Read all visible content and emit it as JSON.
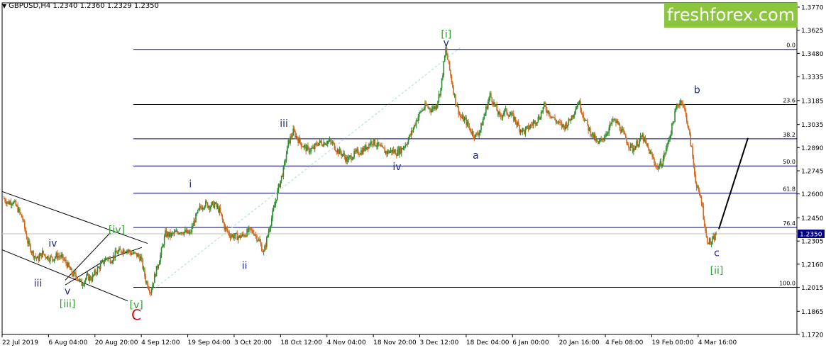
{
  "header": {
    "dropdown_icon": "triangle-down-icon",
    "symbol_info": "GBPUSD,H4  1.2340 1.2360 1.2329 1.2350"
  },
  "brand": {
    "text": "freshforex.com",
    "color": "#8cc63f"
  },
  "chart_data": {
    "type": "candlestick",
    "ylim": [
      1.172,
      1.377
    ],
    "y_ticks": [
      "1.3770",
      "1.3625",
      "1.3480",
      "1.3335",
      "1.3185",
      "1.3035",
      "1.2890",
      "1.2745",
      "1.2600",
      "1.2450",
      "1.2305",
      "1.2160",
      "1.2015",
      "1.1865",
      "1.1720"
    ],
    "y_tick_values": [
      1.377,
      1.3625,
      1.348,
      1.3335,
      1.3185,
      1.3035,
      1.289,
      1.2745,
      1.26,
      1.245,
      1.2305,
      1.216,
      1.2015,
      1.1865,
      1.172
    ],
    "x_ticks": [
      "22 Jul 2019",
      "6 Aug 04:00",
      "20 Aug 20:00",
      "4 Sep 12:00",
      "19 Sep 04:00",
      "3 Oct 20:00",
      "18 Oct 12:00",
      "4 Nov 04:00",
      "18 Nov 20:00",
      "3 Dec 12:00",
      "18 Dec 04:00",
      "6 Jan 00:00",
      "20 Jan 16:00",
      "4 Feb 08:00",
      "19 Feb 00:00",
      "4 Mar 16:00"
    ],
    "current_price": "1.2350",
    "fibonacci_levels": [
      {
        "label": "0.0",
        "price": 1.3505
      },
      {
        "label": "23.6",
        "price": 1.316
      },
      {
        "label": "38.2",
        "price": 1.2945
      },
      {
        "label": "50.0",
        "price": 1.2775
      },
      {
        "label": "61.8",
        "price": 1.2605
      },
      {
        "label": "76.4",
        "price": 1.239
      },
      {
        "label": "100.0",
        "price": 1.2015
      }
    ],
    "price_path": [
      [
        0,
        1.2575
      ],
      [
        1,
        1.2545
      ],
      [
        2,
        1.2555
      ],
      [
        3,
        1.2505
      ],
      [
        4,
        1.244
      ],
      [
        5,
        1.23
      ],
      [
        6,
        1.223
      ],
      [
        7,
        1.219
      ],
      [
        8,
        1.223
      ],
      [
        9,
        1.2205
      ],
      [
        10,
        1.2195
      ],
      [
        11,
        1.2215
      ],
      [
        12,
        1.22
      ],
      [
        13,
        1.216
      ],
      [
        14,
        1.21
      ],
      [
        15,
        1.2085
      ],
      [
        16,
        1.2035
      ],
      [
        17,
        1.208
      ],
      [
        18,
        1.207
      ],
      [
        19,
        1.212
      ],
      [
        20,
        1.216
      ],
      [
        21,
        1.22
      ],
      [
        22,
        1.219
      ],
      [
        23,
        1.223
      ],
      [
        24,
        1.2245
      ],
      [
        25,
        1.2255
      ],
      [
        26,
        1.223
      ],
      [
        27,
        1.222
      ],
      [
        28,
        1.22
      ],
      [
        29,
        1.206
      ],
      [
        30,
        1.199
      ],
      [
        31,
        1.2105
      ],
      [
        32,
        1.2215
      ],
      [
        33,
        1.235
      ],
      [
        34,
        1.234
      ],
      [
        35,
        1.2355
      ],
      [
        36,
        1.237
      ],
      [
        37,
        1.236
      ],
      [
        38,
        1.235
      ],
      [
        39,
        1.244
      ],
      [
        40,
        1.251
      ],
      [
        41,
        1.254
      ],
      [
        42,
        1.2525
      ],
      [
        43,
        1.2535
      ],
      [
        44,
        1.2495
      ],
      [
        45,
        1.2395
      ],
      [
        46,
        1.2345
      ],
      [
        47,
        1.2335
      ],
      [
        48,
        1.233
      ],
      [
        49,
        1.2345
      ],
      [
        50,
        1.237
      ],
      [
        51,
        1.236
      ],
      [
        52,
        1.231
      ],
      [
        53,
        1.223
      ],
      [
        54,
        1.237
      ],
      [
        55,
        1.25
      ],
      [
        56,
        1.264
      ],
      [
        57,
        1.275
      ],
      [
        58,
        1.292
      ],
      [
        59,
        1.299
      ],
      [
        60,
        1.294
      ],
      [
        61,
        1.29
      ],
      [
        62,
        1.2875
      ],
      [
        63,
        1.288
      ],
      [
        64,
        1.292
      ],
      [
        65,
        1.292
      ],
      [
        66,
        1.293
      ],
      [
        67,
        1.2915
      ],
      [
        68,
        1.287
      ],
      [
        69,
        1.285
      ],
      [
        70,
        1.281
      ],
      [
        71,
        1.284
      ],
      [
        72,
        1.286
      ],
      [
        73,
        1.287
      ],
      [
        74,
        1.29
      ],
      [
        75,
        1.293
      ],
      [
        76,
        1.291
      ],
      [
        77,
        1.288
      ],
      [
        78,
        1.286
      ],
      [
        79,
        1.287
      ],
      [
        80,
        1.286
      ],
      [
        81,
        1.288
      ],
      [
        82,
        1.292
      ],
      [
        83,
        1.298
      ],
      [
        84,
        1.306
      ],
      [
        85,
        1.312
      ],
      [
        86,
        1.315
      ],
      [
        87,
        1.313
      ],
      [
        88,
        1.315
      ],
      [
        89,
        1.326
      ],
      [
        90,
        1.351
      ],
      [
        91,
        1.334
      ],
      [
        92,
        1.318
      ],
      [
        93,
        1.308
      ],
      [
        94,
        1.306
      ],
      [
        95,
        1.3
      ],
      [
        96,
        1.296
      ],
      [
        97,
        1.3
      ],
      [
        98,
        1.311
      ],
      [
        99,
        1.322
      ],
      [
        100,
        1.315
      ],
      [
        101,
        1.308
      ],
      [
        102,
        1.312
      ],
      [
        103,
        1.31
      ],
      [
        104,
        1.307
      ],
      [
        105,
        1.301
      ],
      [
        106,
        1.299
      ],
      [
        107,
        1.302
      ],
      [
        108,
        1.305
      ],
      [
        109,
        1.308
      ],
      [
        110,
        1.315
      ],
      [
        111,
        1.311
      ],
      [
        112,
        1.307
      ],
      [
        113,
        1.304
      ],
      [
        114,
        1.302
      ],
      [
        115,
        1.305
      ],
      [
        116,
        1.311
      ],
      [
        117,
        1.318
      ],
      [
        118,
        1.309
      ],
      [
        119,
        1.301
      ],
      [
        120,
        1.296
      ],
      [
        121,
        1.291
      ],
      [
        122,
        1.295
      ],
      [
        123,
        1.3
      ],
      [
        124,
        1.306
      ],
      [
        125,
        1.304
      ],
      [
        126,
        1.298
      ],
      [
        127,
        1.292
      ],
      [
        128,
        1.288
      ],
      [
        129,
        1.292
      ],
      [
        130,
        1.296
      ],
      [
        131,
        1.289
      ],
      [
        132,
        1.283
      ],
      [
        133,
        1.276
      ],
      [
        134,
        1.28
      ],
      [
        135,
        1.29
      ],
      [
        136,
        1.302
      ],
      [
        137,
        1.315
      ],
      [
        138,
        1.319
      ],
      [
        139,
        1.307
      ],
      [
        140,
        1.288
      ],
      [
        141,
        1.264
      ],
      [
        142,
        1.256
      ],
      [
        143,
        1.232
      ],
      [
        144,
        1.229
      ],
      [
        145,
        1.235
      ]
    ],
    "wave_labels": [
      {
        "text": "[i]",
        "color": "green",
        "x": 90,
        "y": 1.358
      },
      {
        "text": "v",
        "color": "navy",
        "x": 90,
        "y": 1.3525
      },
      {
        "text": "iii",
        "color": "navy",
        "x": 57,
        "y": 1.302
      },
      {
        "text": "i",
        "color": "navy",
        "x": 38,
        "y": 1.264
      },
      {
        "text": "ii",
        "color": "navy",
        "x": 49,
        "y": 1.213
      },
      {
        "text": "iv",
        "color": "navy",
        "x": 80,
        "y": 1.275
      },
      {
        "text": "a",
        "color": "navy",
        "x": 96,
        "y": 1.282
      },
      {
        "text": "b",
        "color": "navy",
        "x": 141,
        "y": 1.323
      },
      {
        "text": "c",
        "color": "navy",
        "x": 145,
        "y": 1.221
      },
      {
        "text": "[ii]",
        "color": "green",
        "x": 145,
        "y": 1.21
      },
      {
        "text": "iv",
        "color": "navy",
        "x": 10,
        "y": 1.227
      },
      {
        "text": "iii",
        "color": "navy",
        "x": 7,
        "y": 1.202
      },
      {
        "text": "v",
        "color": "navy",
        "x": 13,
        "y": 1.197
      },
      {
        "text": "[iii]",
        "color": "green",
        "x": 13,
        "y": 1.189
      },
      {
        "text": "[iv]",
        "color": "green",
        "x": 23,
        "y": 1.2355
      },
      {
        "text": "[v]",
        "color": "green",
        "x": 27,
        "y": 1.1885
      },
      {
        "text": "C",
        "color": "red",
        "x": 27,
        "y": 1.181
      }
    ]
  }
}
